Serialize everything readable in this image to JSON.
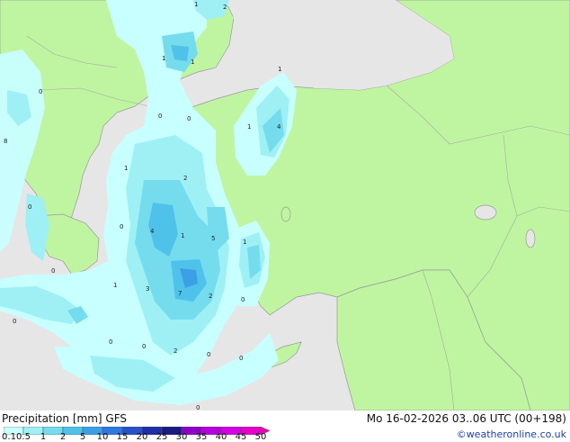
{
  "header": {
    "product": "Precipitation [mm]",
    "model": "GFS",
    "valid_time": "Mo 16-02-2026 03..06 UTC (00+198)"
  },
  "credit": "©weatheronline.co.uk",
  "legend": {
    "ticks": [
      "0.1",
      "0.5",
      "1",
      "2",
      "5",
      "10",
      "15",
      "20",
      "25",
      "30",
      "35",
      "40",
      "45",
      "50"
    ],
    "colors": [
      "#c8ffff",
      "#9ef0f5",
      "#74dced",
      "#4fc2ea",
      "#3ca0e6",
      "#2f78df",
      "#2850c8",
      "#1e2da8",
      "#1a1a80",
      "#8c00c8",
      "#b400dc",
      "#d200e6",
      "#e600c8",
      "#f000b4"
    ]
  },
  "map_colors": {
    "land": "#bff5a0",
    "non_forecast_area": "#e6e6e6",
    "sea": "#e6e6e6",
    "border": "#aaaaaa"
  },
  "value_labels": [
    {
      "text": "2"
    },
    {
      "text": "1"
    },
    {
      "text": "1"
    },
    {
      "text": "0"
    },
    {
      "text": "1"
    },
    {
      "text": "4"
    },
    {
      "text": "1"
    },
    {
      "text": "0"
    },
    {
      "text": "0"
    },
    {
      "text": "8"
    },
    {
      "text": "1"
    },
    {
      "text": "2"
    },
    {
      "text": "0"
    },
    {
      "text": "0"
    },
    {
      "text": "4"
    },
    {
      "text": "1"
    },
    {
      "text": "5"
    },
    {
      "text": "1"
    },
    {
      "text": "0"
    },
    {
      "text": "1"
    },
    {
      "text": "3"
    },
    {
      "text": "7"
    },
    {
      "text": "2"
    },
    {
      "text": "0"
    },
    {
      "text": "0"
    },
    {
      "text": "0"
    },
    {
      "text": "0"
    },
    {
      "text": "2"
    },
    {
      "text": "0"
    },
    {
      "text": "0"
    },
    {
      "text": "0"
    },
    {
      "text": "1"
    }
  ]
}
